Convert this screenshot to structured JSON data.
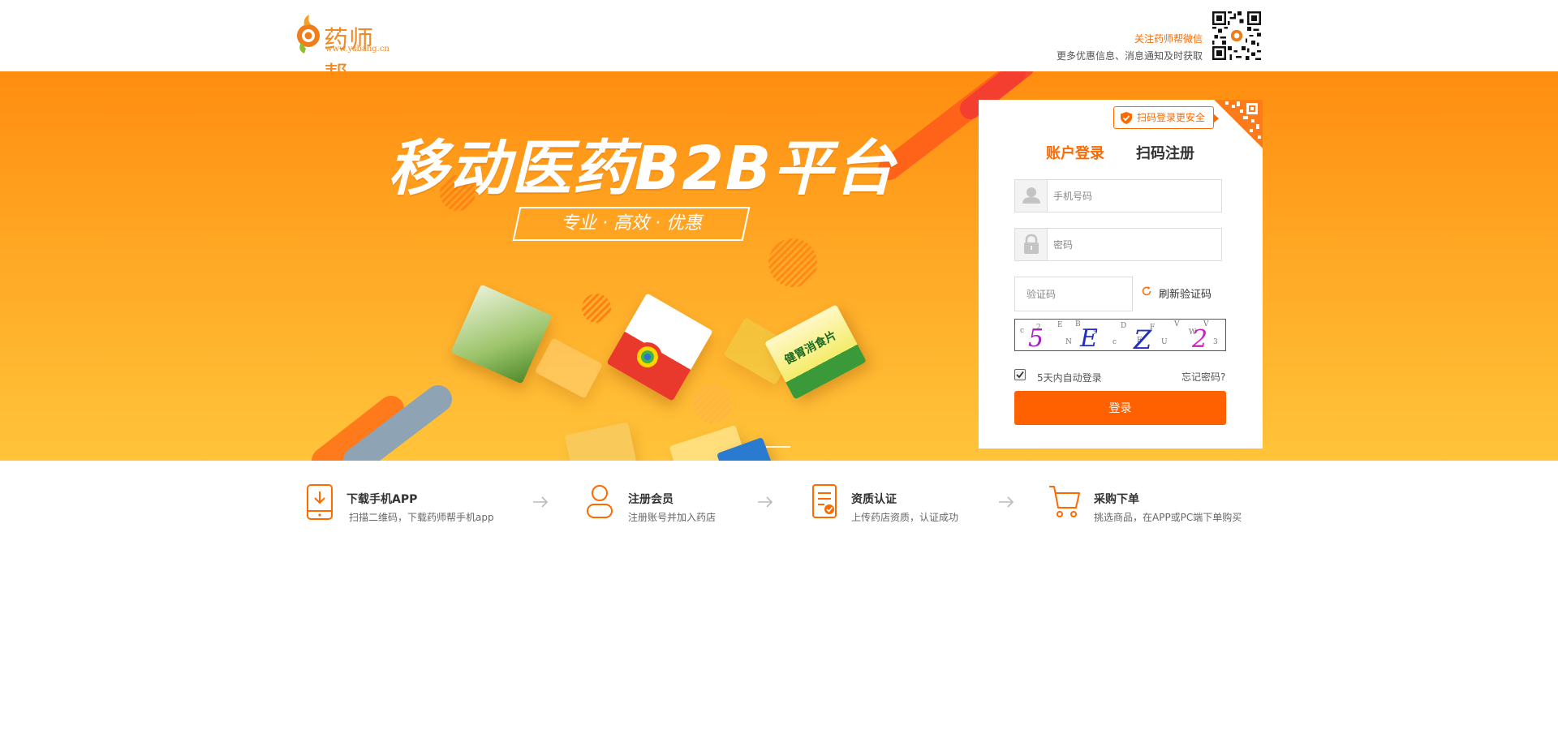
{
  "header": {
    "logo_name": "药师帮",
    "logo_url": "www.ysbang.cn",
    "follow_line1": "关注药师帮微信",
    "follow_line2": "更多优惠信息、消息通知及时获取"
  },
  "banner": {
    "headline": "移动医药B2B平台",
    "slogan": "专业 · 高效 · 优惠",
    "products": [
      "健胃消食片"
    ]
  },
  "login": {
    "scan_tip": "扫码登录更安全",
    "tabs": [
      "账户登录",
      "扫码注册"
    ],
    "active_tab": "账户登录",
    "phone_placeholder": "手机号码",
    "password_placeholder": "密码",
    "captcha_placeholder": "验证码",
    "refresh_label": "刷新验证码",
    "captcha_text": "5 E Z 2",
    "remember_label": "5天内自动登录",
    "remember_checked": true,
    "forgot_label": "忘记密码?",
    "submit_label": "登录"
  },
  "steps": [
    {
      "title": "下载手机APP",
      "desc": "扫描二维码，下载药师帮手机app",
      "icon": "phone-download-icon"
    },
    {
      "title": "注册会员",
      "desc": "注册账号并加入药店",
      "icon": "user-icon"
    },
    {
      "title": "资质认证",
      "desc": "上传药店资质，认证成功",
      "icon": "document-check-icon"
    },
    {
      "title": "采购下单",
      "desc": "挑选商品，在APP或PC端下单购买",
      "icon": "cart-icon"
    }
  ],
  "colors": {
    "accent": "#ff6a00",
    "banner_top": "#ff8d10",
    "banner_bottom": "#ffc43a",
    "button": "#ff6000"
  }
}
